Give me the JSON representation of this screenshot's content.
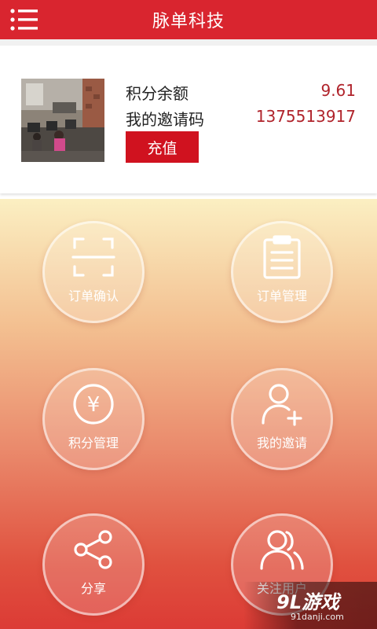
{
  "header": {
    "title": "脉单科技"
  },
  "account": {
    "points_label": "积分余额",
    "points_value": "9.61",
    "invite_label": "我的邀请码",
    "invite_value": "1375513917",
    "recharge_label": "充值"
  },
  "tiles": [
    {
      "label": "订单确认",
      "icon": "scan-icon"
    },
    {
      "label": "订单管理",
      "icon": "clipboard-icon"
    },
    {
      "label": "积分管理",
      "icon": "yen-coin-icon"
    },
    {
      "label": "我的邀请",
      "icon": "add-user-icon"
    },
    {
      "label": "分享",
      "icon": "share-icon"
    },
    {
      "label": "关注用户",
      "icon": "users-icon"
    }
  ],
  "watermark": {
    "brand": "9L游戏",
    "url": "91danji.com"
  },
  "colors": {
    "header": "#d9252f",
    "button": "#d0121f",
    "value_text": "#b0232b"
  }
}
